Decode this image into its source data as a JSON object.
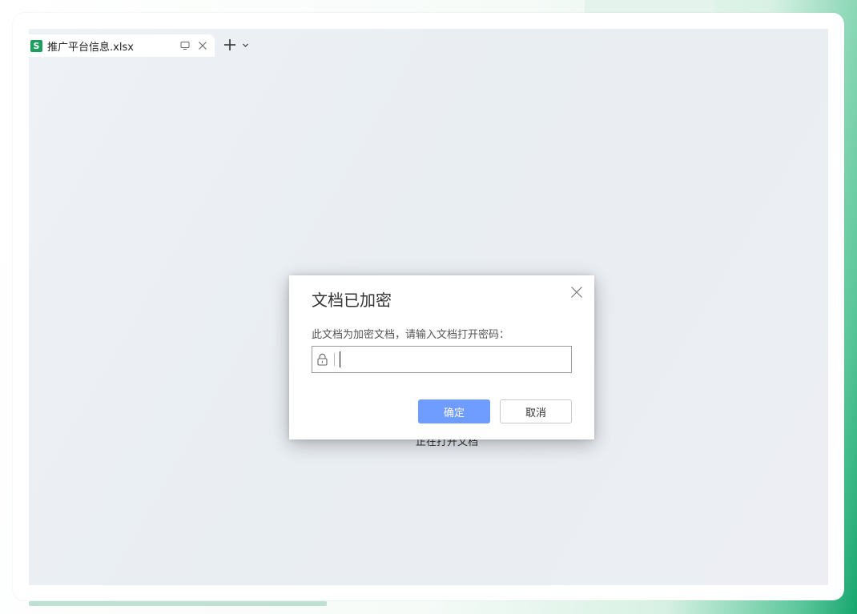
{
  "tab": {
    "file_icon_letter": "S",
    "label": "推广平台信息.xlsx",
    "icons": [
      "monitor-icon",
      "close-icon"
    ]
  },
  "tab_strip": {
    "icons": [
      "plus-icon",
      "chevron-down-icon"
    ]
  },
  "background_text": "正在打开文档",
  "dialog": {
    "title": "文档已加密",
    "message": "此文档为加密文档，请输入文档打开密码：",
    "password_value": "",
    "ok_label": "确定",
    "cancel_label": "取消",
    "icons": [
      "close-icon",
      "lock-icon"
    ]
  },
  "colors": {
    "primary_button": "#6f9cff",
    "file_icon": "#1e9e5c",
    "accent_green": "#17a66e"
  }
}
